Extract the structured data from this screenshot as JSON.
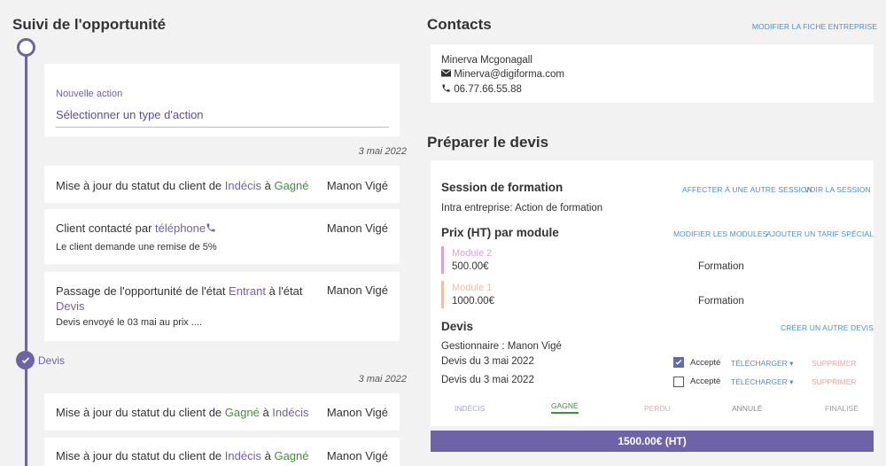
{
  "left": {
    "title": "Suivi de l'opportunité",
    "new_action": {
      "label": "Nouvelle action",
      "select_value": "Sélectionner un type d'action"
    },
    "dates": [
      "3 mai 2022",
      "3 mai 2022"
    ],
    "stage_label": "Devis",
    "cards": [
      {
        "p1": "Mise à jour du statut du client de ",
        "from": "Indécis",
        "p2": " à ",
        "to": "Gagné",
        "user": "Manon Vigé"
      },
      {
        "p1": "Client contacté par ",
        "channel": "téléphone",
        "note": "Le client demande une remise de 5%",
        "user": "Manon Vigé"
      },
      {
        "p1": "Passage de l'opportunité de l'état ",
        "from": "Entrant",
        "p2": " à l'état",
        "to": "Devis",
        "note": "Devis envoyé le 03 mai au prix ....",
        "user": "Manon Vigé"
      },
      {
        "p1": "Mise à jour du statut du client de ",
        "from": "Gagné",
        "p2": " à ",
        "to": "Indécis",
        "user": "Manon Vigé"
      },
      {
        "p1": "Mise à jour du statut du client de ",
        "from": "Indécis",
        "p2": " à ",
        "to": "Gagné",
        "user": "Manon Vigé"
      }
    ]
  },
  "contacts": {
    "title": "Contacts",
    "edit_link": "MODIFIER LA FICHE ENTREPRISE",
    "name": "Minerva Mcgonagall",
    "email": "Minerva@digiforma.com",
    "phone": "06.77.66.55.88"
  },
  "devis": {
    "title": "Préparer le devis",
    "session": {
      "heading": "Session de formation",
      "link1": "AFFECTER À UNE AUTRE SESSION",
      "link2": "VOIR LA SESSION",
      "text": "Intra entreprise: Action de formation"
    },
    "prix": {
      "heading": "Prix (HT) par module",
      "link1": "MODIFIER LES MODULES",
      "link2": "AJOUTER UN TARIF SPÉCIAL",
      "modules": [
        {
          "name": "Module 2",
          "price": "500.00€",
          "type": "Formation",
          "color": "#d9a3d6"
        },
        {
          "name": "Module 1",
          "price": "1000.00€",
          "type": "Formation",
          "color": "#e6c2a8"
        }
      ]
    },
    "devis_block": {
      "heading": "Devis",
      "create_link": "CRÉER UN AUTRE DEVIS",
      "manager": "Gestionnaire : Manon Vigé",
      "rows": [
        {
          "label": "Devis du 3 mai 2022",
          "accepted": true,
          "accept_label": "Accepté",
          "download": "TÉLÉCHARGER",
          "delete": "SUPPRIMER"
        },
        {
          "label": "Devis du 3 mai 2022",
          "accepted": false,
          "accept_label": "Accepté",
          "download": "TÉLÉCHARGER",
          "delete": "SUPPRIMER"
        }
      ]
    },
    "steps": [
      {
        "label": "INDÉCIS",
        "color": "#a9a9c9"
      },
      {
        "label": "GAGNÉ",
        "color": "#3f8f3f",
        "active": true
      },
      {
        "label": "PERDU",
        "color": "#e8a7a7"
      },
      {
        "label": "ANNULÉ",
        "color": "#888888"
      },
      {
        "label": "FINALISÉ",
        "color": "#a0a0a0"
      }
    ],
    "total": "1500.00€ (HT)"
  },
  "colors": {
    "accent": "#6f63a8",
    "link": "#4a8fd0",
    "green": "#3f8f3f"
  }
}
